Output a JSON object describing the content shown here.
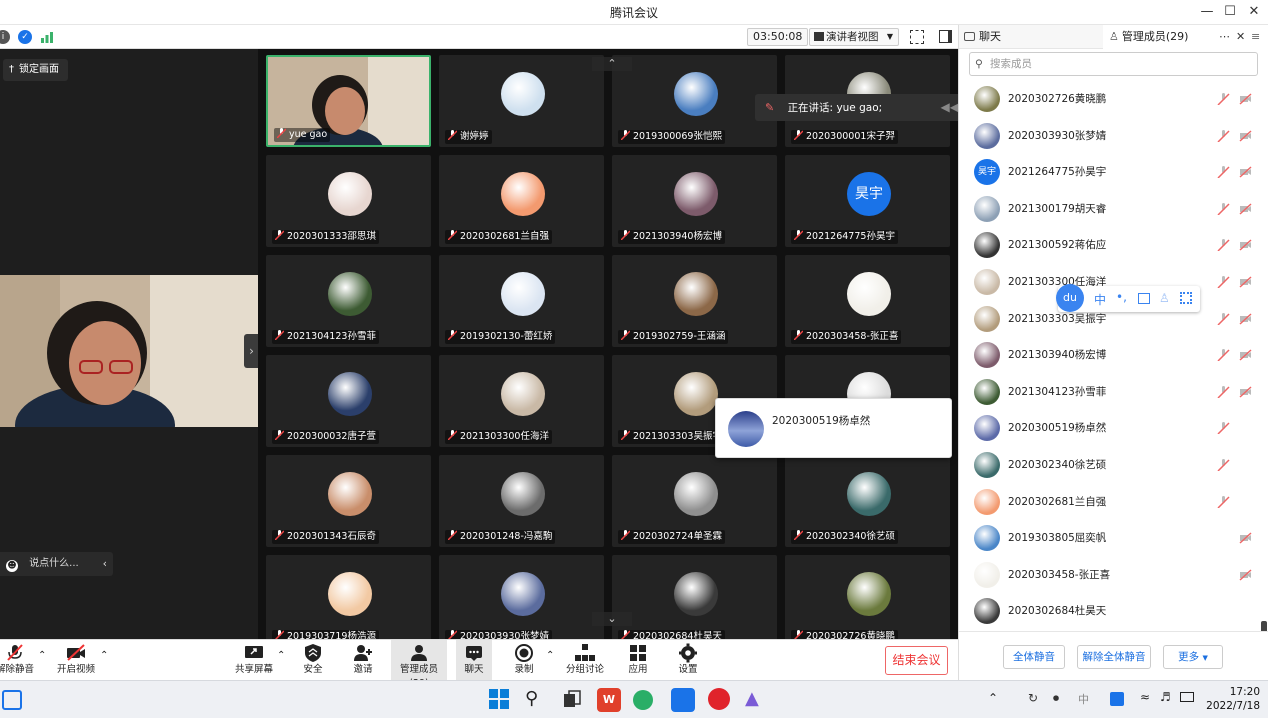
{
  "app": {
    "title": "腾讯会议"
  },
  "toolbar": {
    "timer": "03:50:08",
    "view_label": "演讲者视图"
  },
  "left": {
    "lock_label": "锁定画面",
    "chat_placeholder": "说点什么..."
  },
  "main_speaker": {
    "name": "yue gao"
  },
  "speaking_banner": "正在讲话: yue gao;",
  "tiles": [
    {
      "name": "yue gao",
      "avatar": "video",
      "color": "#c9b9a3",
      "active": true
    },
    {
      "name": "谢婷婷",
      "avatar": "girl-cartoon-icon",
      "color": "#cfe0ef"
    },
    {
      "name": "2019300069张恺熙",
      "avatar": "sky-avatar-icon",
      "color": "#4a7ec0"
    },
    {
      "name": "2020300001宋子羿",
      "avatar": "person-avatar-icon",
      "color": "#8a8a7a"
    },
    {
      "name": "2020301333邵思琪",
      "avatar": "flower-avatar-icon",
      "color": "#e7d6d0"
    },
    {
      "name": "2020302681兰自强",
      "avatar": "anime-avatar-icon",
      "color": "#f39a6f"
    },
    {
      "name": "2021303940杨宏博",
      "avatar": "sunset-avatar-icon",
      "color": "#7d5b6b"
    },
    {
      "name": "2021264775孙昊宇",
      "avatar": "text",
      "text": "昊宇",
      "color": "#1a73e8"
    },
    {
      "name": "2021304123孙雪菲",
      "avatar": "nature-avatar-icon",
      "color": "#3d5b33"
    },
    {
      "name": "2019302130-蕾红娇",
      "avatar": "couple-cartoon-icon",
      "color": "#dbe5f2"
    },
    {
      "name": "2019302759-王涵涵",
      "avatar": "room-avatar-icon",
      "color": "#8c6848"
    },
    {
      "name": "2020303458-张正喜",
      "avatar": "kids-avatar-icon",
      "color": "#f1efe9"
    },
    {
      "name": "2020300032唐子萱",
      "avatar": "night-avatar-icon",
      "color": "#2b3f6b"
    },
    {
      "name": "2021303300任海洋",
      "avatar": "feet-avatar-icon",
      "color": "#c9b9a6"
    },
    {
      "name": "2021303303吴振宇",
      "avatar": "cat-avatar-icon",
      "color": "#b29c7c"
    },
    {
      "name": "2020300519杨卓然",
      "avatar": "anime-boy-icon",
      "color": "#dcdcdc"
    },
    {
      "name": "2020301343石辰奇",
      "avatar": "anime-eyes-icon",
      "color": "#c98e6b"
    },
    {
      "name": "2020301248-冯嘉駒",
      "avatar": "cat-cartoon-icon",
      "color": "#6c6c6c"
    },
    {
      "name": "2020302724单圣霖",
      "avatar": "bw-photo-icon",
      "color": "#8f8f8f"
    },
    {
      "name": "2020302340徐艺硕",
      "avatar": "anime-man-icon",
      "color": "#3a6a6a"
    },
    {
      "name": "2019303719杨浩源",
      "avatar": "anime-girl-icon",
      "color": "#f2c9a3"
    },
    {
      "name": "2020303930张梦婧",
      "avatar": "girl-photo-icon",
      "color": "#5b6c9e"
    },
    {
      "name": "2020302684杜昊天",
      "avatar": "dark-photo-icon",
      "color": "#3a3a3a"
    },
    {
      "name": "2020302726黄晓鹏",
      "avatar": "garden-avatar-icon",
      "color": "#6b7a3d"
    }
  ],
  "popup": {
    "name": "2020300519杨卓然"
  },
  "panel": {
    "tab_chat": "聊天",
    "tab_members": "管理成员(29)",
    "search_placeholder": "搜索成员",
    "members": [
      {
        "name": "2020302726黄晓鹏",
        "color": "#7d7a4a",
        "mic": "muted",
        "cam": "off"
      },
      {
        "name": "2020303930张梦婧",
        "color": "#5b6c9e",
        "mic": "muted",
        "cam": "off"
      },
      {
        "name": "2021264775孙昊宇",
        "color": "#1a73e8",
        "text": "昊宇",
        "mic": "muted",
        "cam": "off"
      },
      {
        "name": "2021300179胡天睿",
        "color": "#8da0b5",
        "mic": "muted",
        "cam": "off"
      },
      {
        "name": "2021300592蒋佑应",
        "color": "#333333",
        "mic": "muted",
        "cam": "off"
      },
      {
        "name": "2021303300任海洋",
        "color": "#c9b9a6",
        "mic": "muted",
        "cam": "off"
      },
      {
        "name": "2021303303吴振宇",
        "color": "#b29c7c",
        "mic": "muted",
        "cam": "off"
      },
      {
        "name": "2021303940杨宏博",
        "color": "#7d5b6b",
        "mic": "muted",
        "cam": "off"
      },
      {
        "name": "2021304123孙雪菲",
        "color": "#3d5b33",
        "mic": "muted",
        "cam": "off"
      },
      {
        "name": "2020300519杨卓然",
        "color": "#5c6aa8",
        "mic": "muted",
        "cam": "none"
      },
      {
        "name": "2020302340徐艺硕",
        "color": "#3a6a6a",
        "mic": "muted",
        "cam": "none"
      },
      {
        "name": "2020302681兰自强",
        "color": "#f39a6f",
        "mic": "muted",
        "cam": "none"
      },
      {
        "name": "2019303805屈奕帆",
        "color": "#4a86c8",
        "mic": "none",
        "cam": "off"
      },
      {
        "name": "2020303458-张正喜",
        "color": "#f1efe9",
        "mic": "none",
        "cam": "off"
      },
      {
        "name": "2020302684杜昊天",
        "color": "#3a3a3a",
        "mic": "none",
        "cam": "none"
      }
    ],
    "btn_mute_all": "全体静音",
    "btn_unmute_all": "解除全体静音",
    "btn_more": "更多"
  },
  "bottom": {
    "unmute": "解除静音",
    "video": "开启视频",
    "share": "共享屏幕",
    "security": "安全",
    "invite": "邀请",
    "members": "管理成员(29)",
    "chat": "聊天",
    "record": "录制",
    "breakout": "分组讨论",
    "apps": "应用",
    "settings": "设置",
    "end": "结束会议"
  },
  "taskbar": {
    "time": "17:20",
    "date": "2022/7/18"
  },
  "colors": {
    "accent": "#1a73e8",
    "end": "#e33333",
    "active_border": "#3bb26b"
  }
}
